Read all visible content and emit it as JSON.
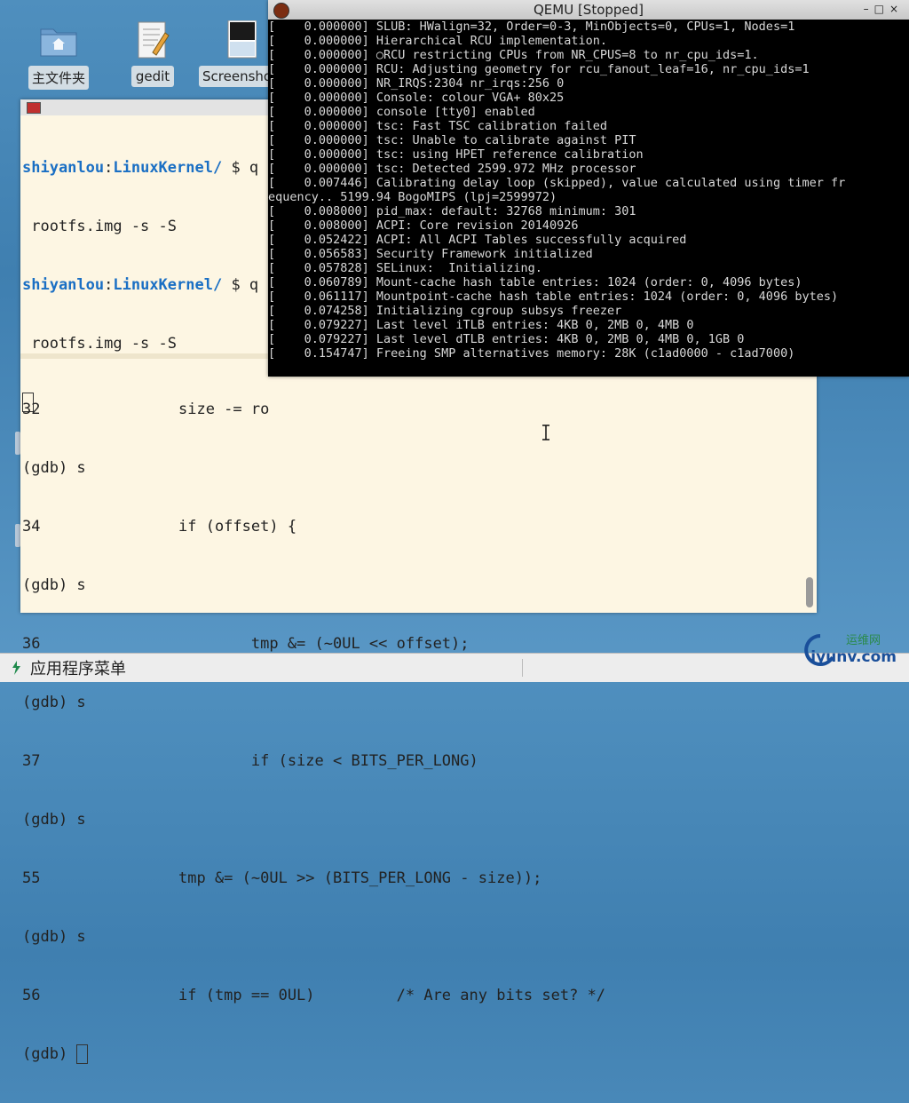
{
  "desktop": {
    "icons": [
      {
        "label": "主文件夹",
        "icon": "folder-home-icon"
      },
      {
        "label": "gedit",
        "icon": "text-editor-icon"
      },
      {
        "label": "Screensho",
        "icon": "screenshot-thumbnail-icon"
      }
    ]
  },
  "terminal": {
    "top_lines": [
      {
        "user": "shiyanlou",
        "sep": ":",
        "path": "LinuxKernel/",
        "rest": " $ q"
      },
      {
        "text": " rootfs.img -s -S"
      },
      {
        "user": "shiyanlou",
        "sep": ":",
        "path": "LinuxKernel/",
        "rest": " $ q"
      },
      {
        "text": " rootfs.img -s -S"
      }
    ],
    "gdb_lines": [
      {
        "ln": "32",
        "code": "size -= ro"
      },
      {
        "ln": "(gdb) s",
        "code": ""
      },
      {
        "ln": "34",
        "code": "if (offset) {"
      },
      {
        "ln": "(gdb) s",
        "code": ""
      },
      {
        "ln": "36",
        "code": "        tmp &= (~0UL << offset);"
      },
      {
        "ln": "(gdb) s",
        "code": ""
      },
      {
        "ln": "37",
        "code": "        if (size < BITS_PER_LONG)"
      },
      {
        "ln": "(gdb) s",
        "code": ""
      },
      {
        "ln": "55",
        "code": "tmp &= (~0UL >> (BITS_PER_LONG - size));"
      },
      {
        "ln": "(gdb) s",
        "code": ""
      },
      {
        "ln": "56",
        "code": "if (tmp == 0UL)         /* Are any bits set? */"
      },
      {
        "ln": "(gdb) ",
        "code": ""
      }
    ]
  },
  "qemu": {
    "title": "QEMU [Stopped]",
    "buttons": [
      "–",
      "□",
      "×"
    ],
    "log": [
      "[    0.000000] SLUB: HWalign=32, Order=0-3, MinObjects=0, CPUs=1, Nodes=1",
      "[    0.000000] Hierarchical RCU implementation.",
      "[    0.000000] ○RCU restricting CPUs from NR_CPUS=8 to nr_cpu_ids=1.",
      "[    0.000000] RCU: Adjusting geometry for rcu_fanout_leaf=16, nr_cpu_ids=1",
      "[    0.000000] NR_IRQS:2304 nr_irqs:256 0",
      "[    0.000000] Console: colour VGA+ 80x25",
      "[    0.000000] console [tty0] enabled",
      "[    0.000000] tsc: Fast TSC calibration failed",
      "[    0.000000] tsc: Unable to calibrate against PIT",
      "[    0.000000] tsc: using HPET reference calibration",
      "[    0.000000] tsc: Detected 2599.972 MHz processor",
      "[    0.007446] Calibrating delay loop (skipped), value calculated using timer fr",
      "equency.. 5199.94 BogoMIPS (lpj=2599972)",
      "[    0.008000] pid_max: default: 32768 minimum: 301",
      "[    0.008000] ACPI: Core revision 20140926",
      "[    0.052422] ACPI: All ACPI Tables successfully acquired",
      "[    0.056583] Security Framework initialized",
      "[    0.057828] SELinux:  Initializing.",
      "[    0.060789] Mount-cache hash table entries: 1024 (order: 0, 4096 bytes)",
      "[    0.061117] Mountpoint-cache hash table entries: 1024 (order: 0, 4096 bytes)",
      "[    0.074258] Initializing cgroup subsys freezer",
      "[    0.079227] Last level iTLB entries: 4KB 0, 2MB 0, 4MB 0",
      "[    0.079227] Last level dTLB entries: 4KB 0, 2MB 0, 4MB 0, 1GB 0",
      "[    0.154747] Freeing SMP alternatives memory: 28K (c1ad0000 - c1ad7000)"
    ]
  },
  "taskbar": {
    "menu_label": "应用程序菜单"
  },
  "watermark": {
    "line1": "运维网",
    "line2": "iyunv.com"
  }
}
